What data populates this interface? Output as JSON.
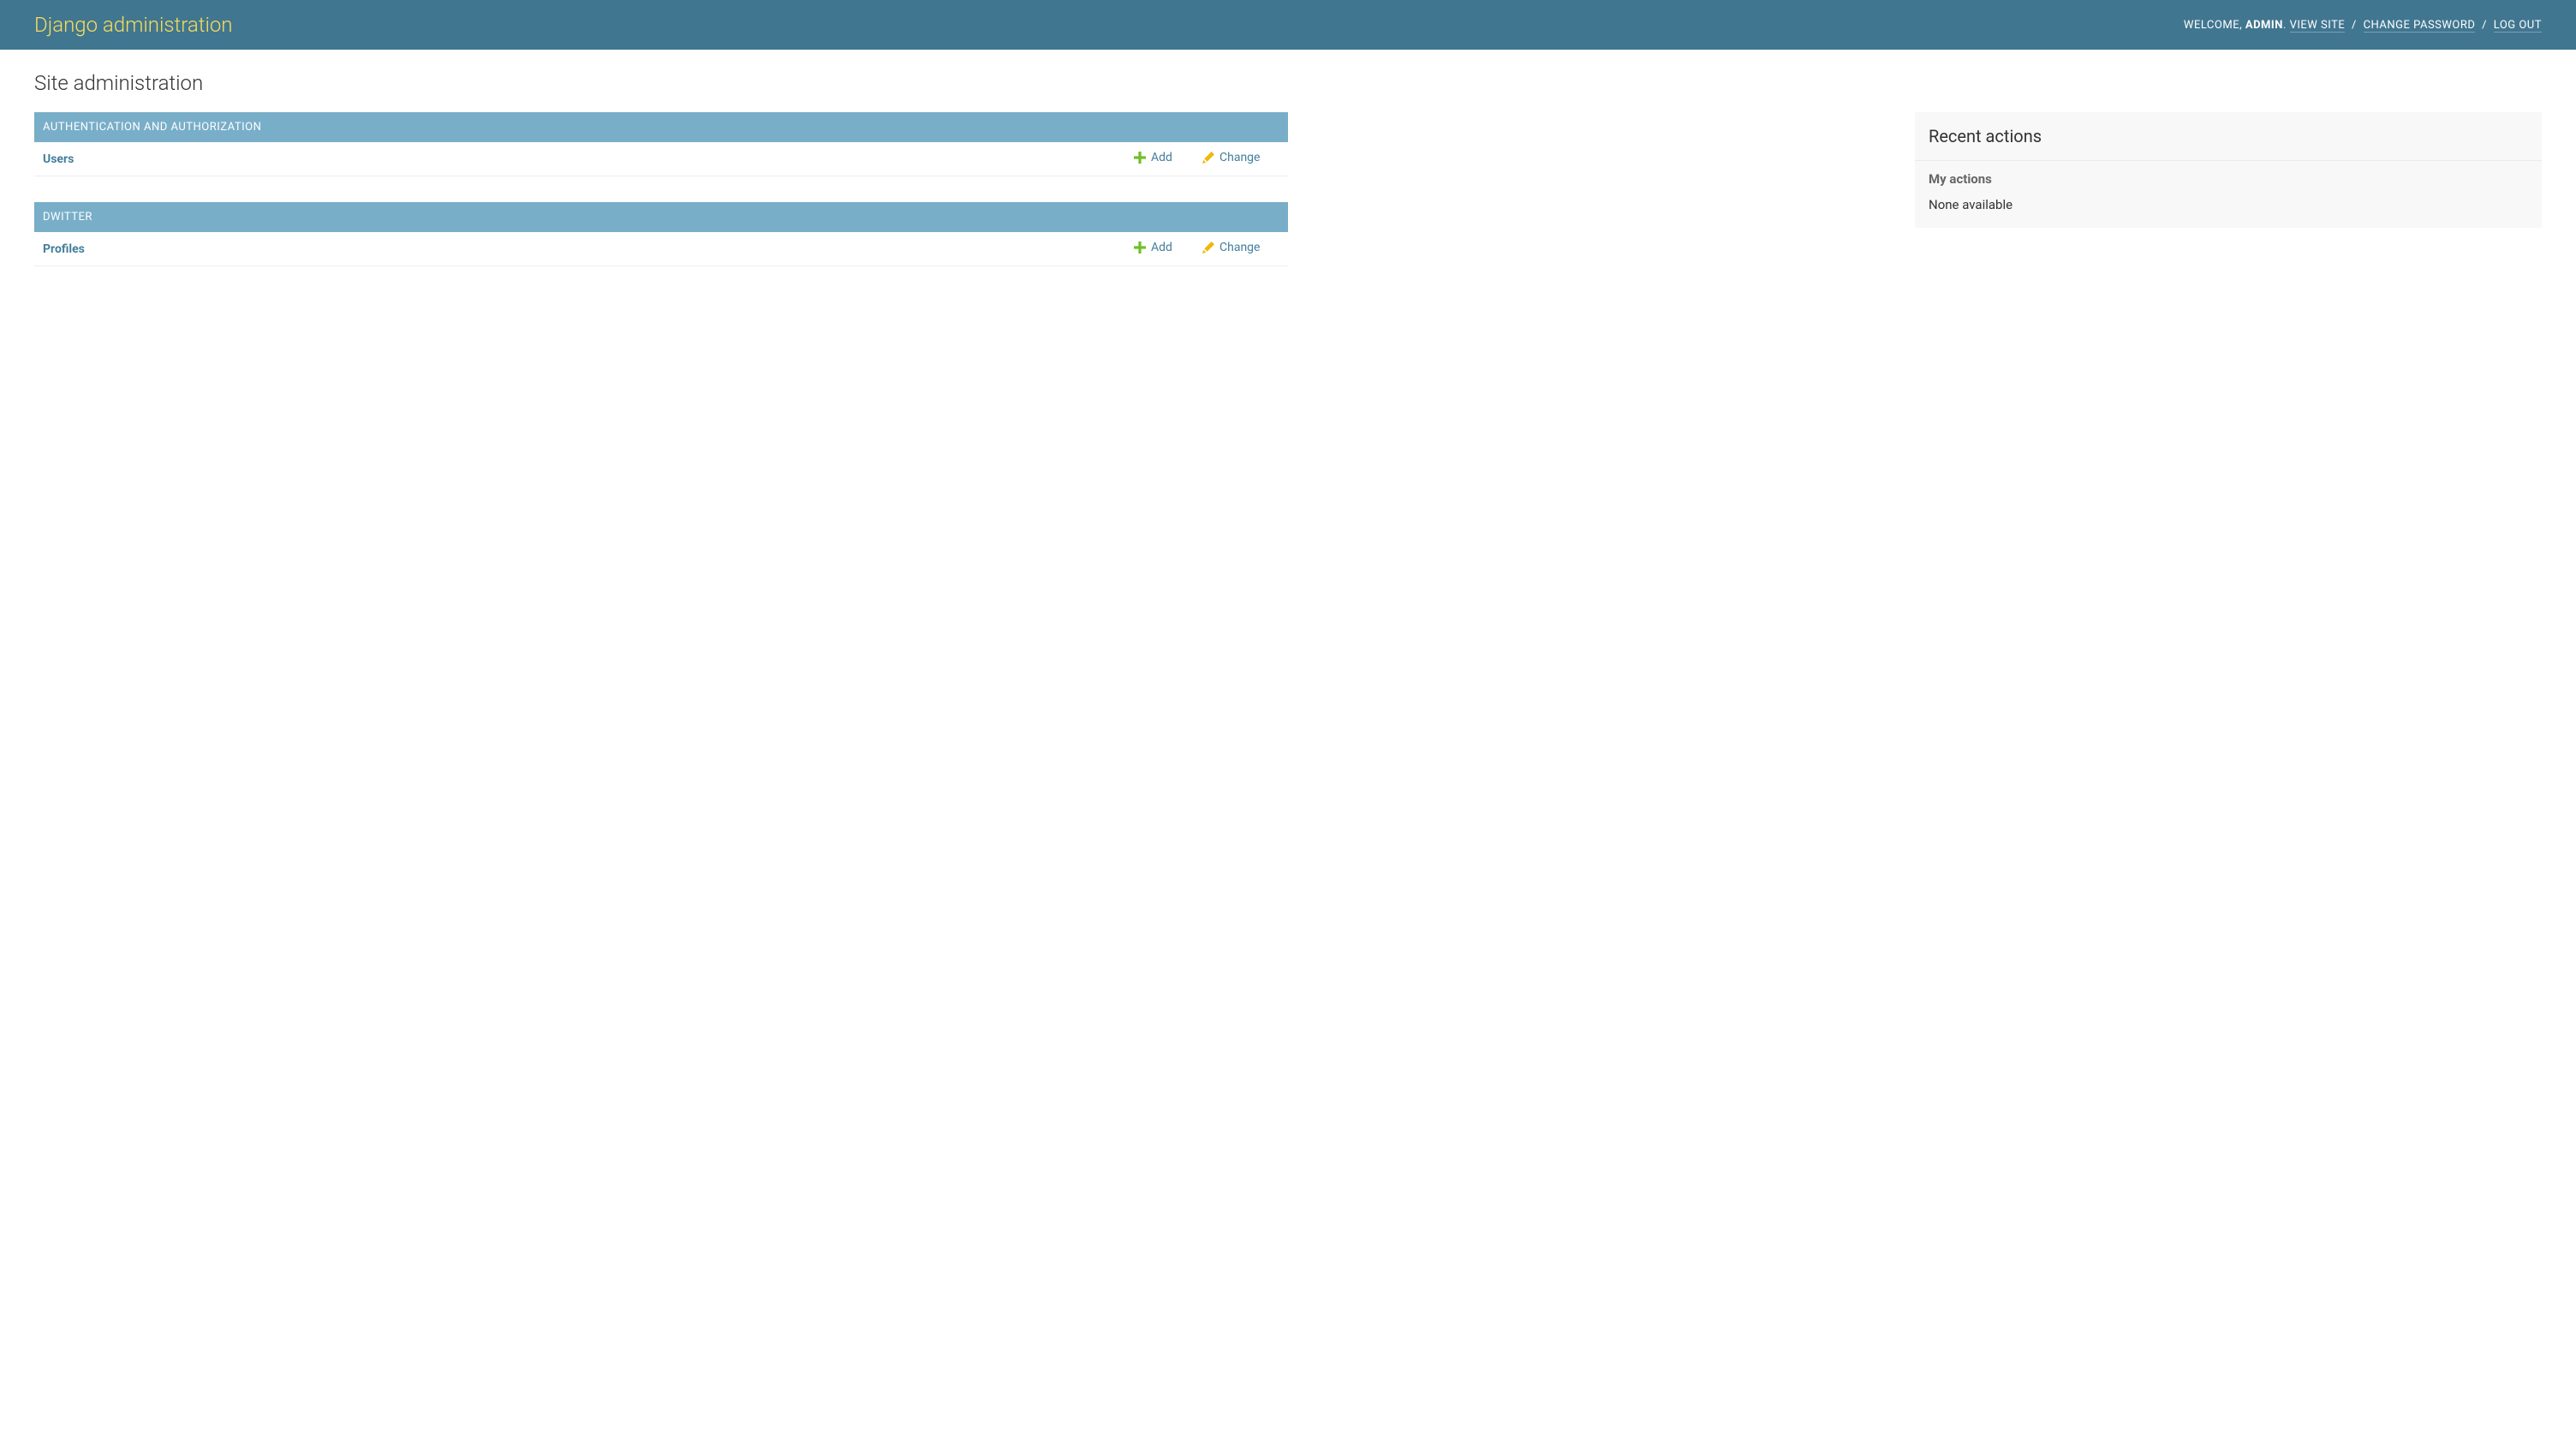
{
  "header": {
    "site_title": "Django administration",
    "welcome_prefix": "WELCOME, ",
    "username": "ADMIN",
    "view_site": "VIEW SITE",
    "change_password": "CHANGE PASSWORD",
    "log_out": "LOG OUT",
    "separator": " / ",
    "period": ". "
  },
  "page": {
    "title": "Site administration"
  },
  "apps": [
    {
      "name": "AUTHENTICATION AND AUTHORIZATION",
      "models": [
        {
          "name": "Users",
          "add": "Add",
          "change": "Change"
        }
      ]
    },
    {
      "name": "DWITTER",
      "models": [
        {
          "name": "Profiles",
          "add": "Add",
          "change": "Change"
        }
      ]
    }
  ],
  "recent_actions": {
    "title": "Recent actions",
    "subheading": "My actions",
    "none_text": "None available"
  }
}
